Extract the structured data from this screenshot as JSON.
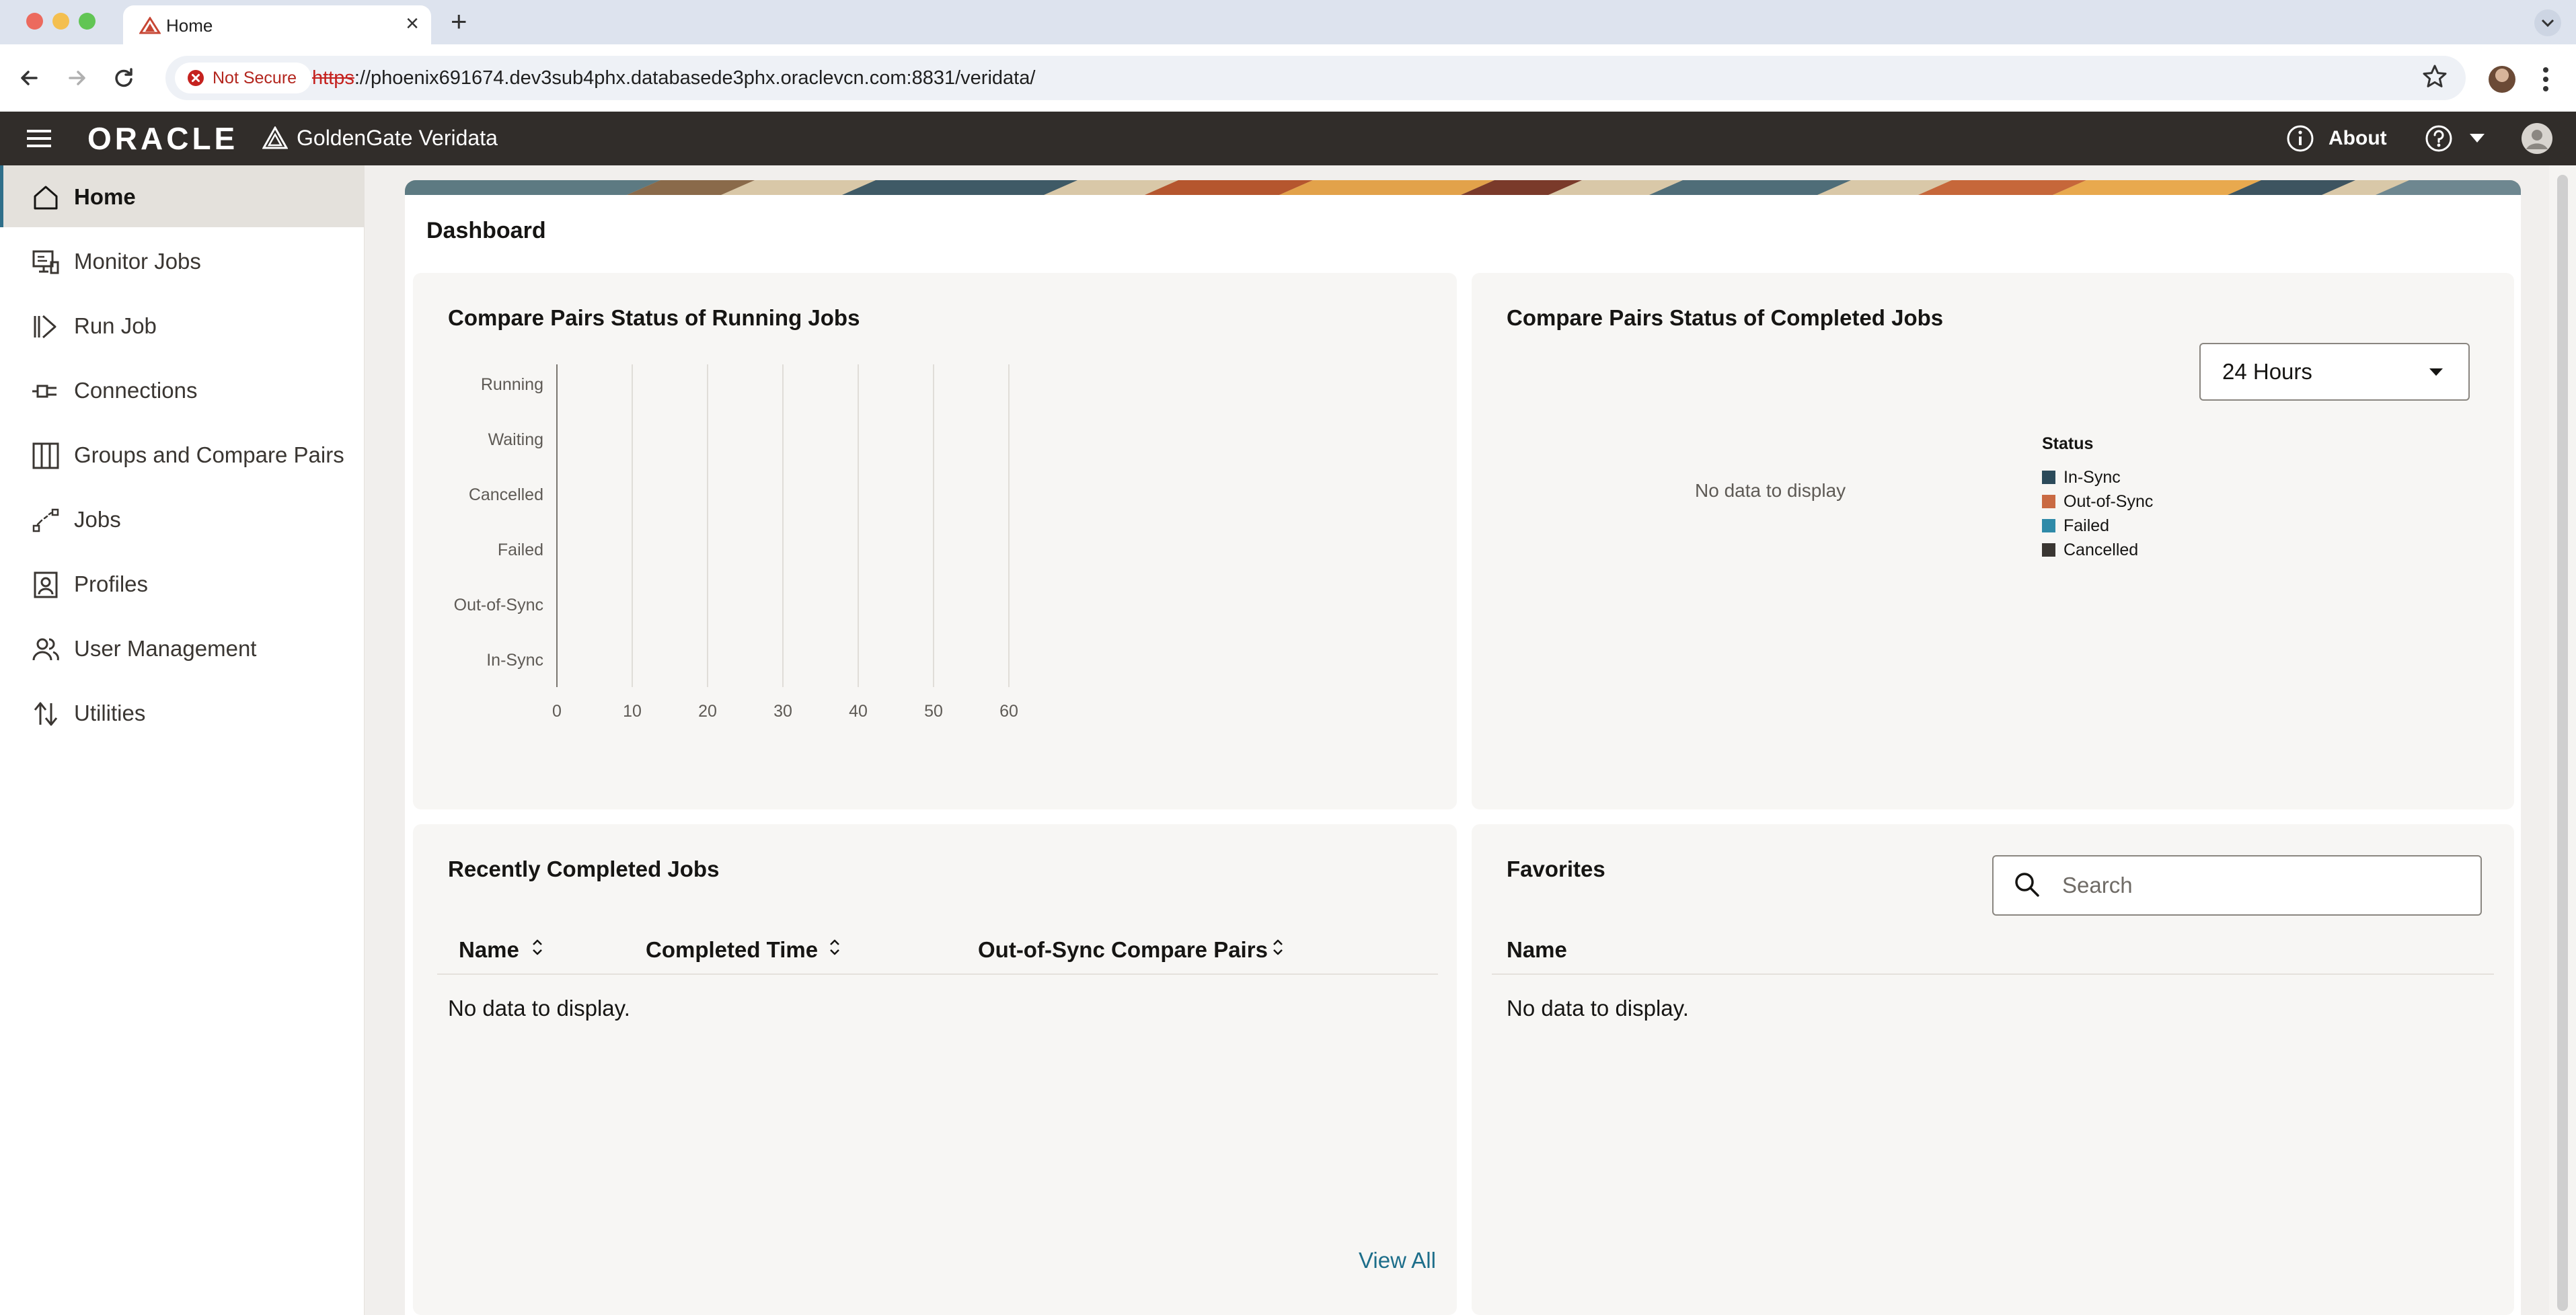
{
  "browser": {
    "tab_title": "Home",
    "url_scheme": "https",
    "url_rest": "://phoenix691674.dev3sub4phx.databasede3phx.oraclevcn.com:8831/veridata/",
    "security_label": "Not Secure"
  },
  "header": {
    "brand": "ORACLE",
    "app_name": "GoldenGate Veridata",
    "about_label": "About"
  },
  "sidebar": {
    "items": [
      {
        "label": "Home",
        "icon": "home-icon",
        "active": true
      },
      {
        "label": "Monitor Jobs",
        "icon": "monitor-icon"
      },
      {
        "label": "Run Job",
        "icon": "run-job-icon"
      },
      {
        "label": "Connections",
        "icon": "connection-plug-icon"
      },
      {
        "label": "Groups and Compare Pairs",
        "icon": "columns-icon"
      },
      {
        "label": "Jobs",
        "icon": "jobs-flow-icon"
      },
      {
        "label": "Profiles",
        "icon": "profile-icon"
      },
      {
        "label": "User Management",
        "icon": "users-icon"
      },
      {
        "label": "Utilities",
        "icon": "transfer-arrows-icon"
      }
    ]
  },
  "dashboard": {
    "title": "Dashboard",
    "running_panel": {
      "title": "Compare Pairs Status of Running Jobs"
    },
    "completed_panel": {
      "title": "Compare Pairs Status of Completed Jobs",
      "range_value": "24 Hours",
      "no_data": "No data to display",
      "legend": {
        "title": "Status",
        "items": [
          {
            "label": "In-Sync",
            "color": "#2b4a5a"
          },
          {
            "label": "Out-of-Sync",
            "color": "#c96a43"
          },
          {
            "label": "Failed",
            "color": "#2f8aa8"
          },
          {
            "label": "Cancelled",
            "color": "#3a3632"
          }
        ]
      }
    },
    "recent_jobs": {
      "title": "Recently Completed Jobs",
      "columns": [
        "Name",
        "Completed Time",
        "Out-of-Sync Compare Pairs"
      ],
      "no_data": "No data to display.",
      "view_all": "View All"
    },
    "favorites": {
      "title": "Favorites",
      "search_placeholder": "Search",
      "columns": [
        "Name"
      ],
      "no_data": "No data to display."
    }
  },
  "chart_data": {
    "type": "bar",
    "orientation": "horizontal",
    "categories": [
      "Running",
      "Waiting",
      "Cancelled",
      "Failed",
      "Out-of-Sync",
      "In-Sync"
    ],
    "values": [
      null,
      null,
      null,
      null,
      null,
      null
    ],
    "xlim": [
      0,
      60
    ],
    "xticks": [
      0,
      10,
      20,
      30,
      40,
      50,
      60
    ],
    "grid": true
  }
}
